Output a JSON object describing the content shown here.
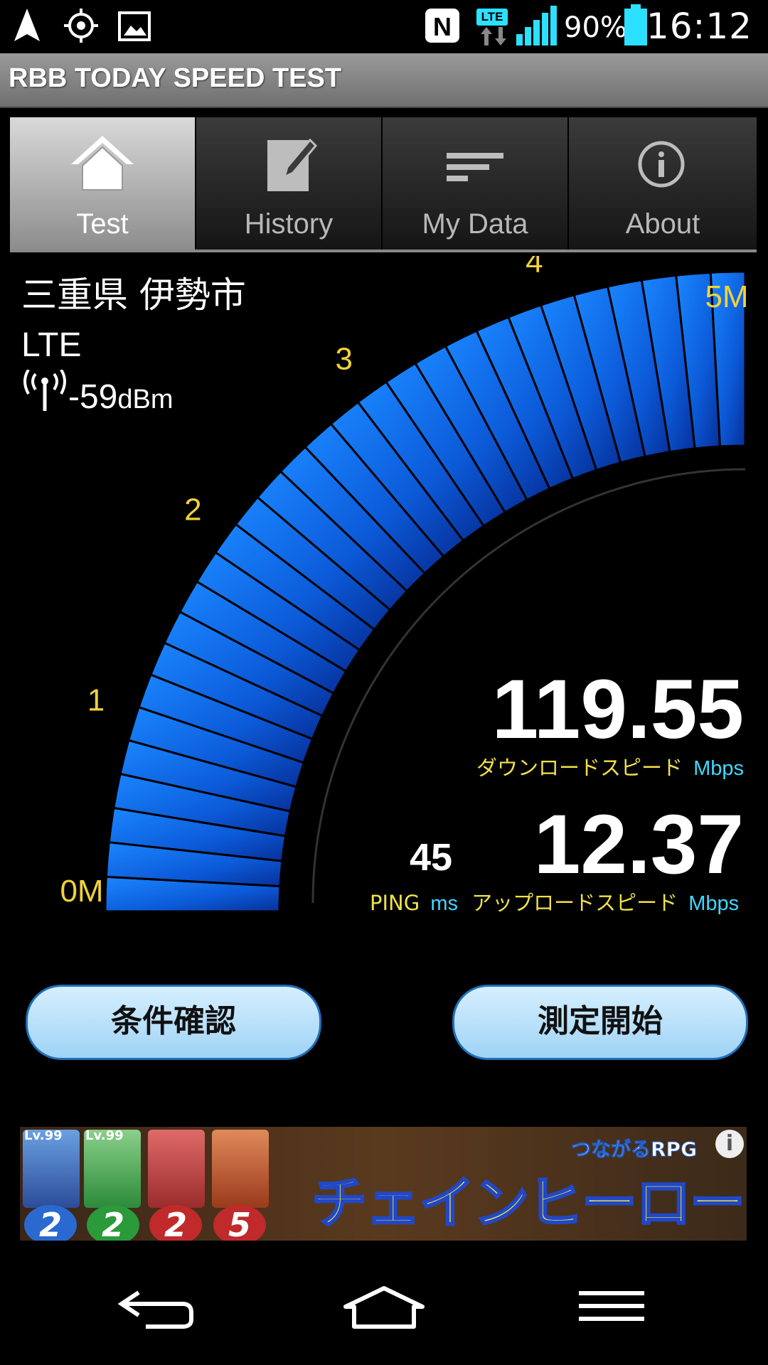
{
  "status_bar": {
    "network_type": "LTE",
    "battery_percent": "90%",
    "time": "16:12",
    "icons": [
      "navigation-icon",
      "gps-icon",
      "image-icon",
      "nfc-icon",
      "lte-icon",
      "signal-icon",
      "battery-icon"
    ]
  },
  "app": {
    "title": "RBB TODAY SPEED TEST"
  },
  "tabs": [
    {
      "label": "Test",
      "icon": "home-icon",
      "active": true
    },
    {
      "label": "History",
      "icon": "edit-icon",
      "active": false
    },
    {
      "label": "My Data",
      "icon": "list-icon",
      "active": false
    },
    {
      "label": "About",
      "icon": "info-icon",
      "active": false
    }
  ],
  "location": {
    "place": "三重県 伊勢市",
    "network": "LTE",
    "signal_value": "-59",
    "signal_unit": "dBm"
  },
  "gauge": {
    "tick_labels": [
      "0M",
      "1",
      "2",
      "3",
      "4",
      "5M"
    ],
    "segments_lit": 29
  },
  "results": {
    "download": {
      "value": "119.55",
      "label": "ダウンロードスピード",
      "unit": "Mbps"
    },
    "upload": {
      "value": "12.37",
      "label": "アップロードスピード",
      "unit": "Mbps"
    },
    "ping": {
      "value": "45",
      "label": "PING",
      "unit": "ms"
    }
  },
  "buttons": {
    "conditions": "条件確認",
    "start": "測定開始"
  },
  "ad": {
    "title": "チェインヒーローズ",
    "subtitle": "つながるRPG",
    "card_level": "Lv.99",
    "numbers": [
      "2",
      "2",
      "2",
      "5"
    ],
    "info_icon": "i"
  },
  "nav_bar": {
    "icons": [
      "back-icon",
      "home-icon",
      "menu-icon"
    ]
  }
}
